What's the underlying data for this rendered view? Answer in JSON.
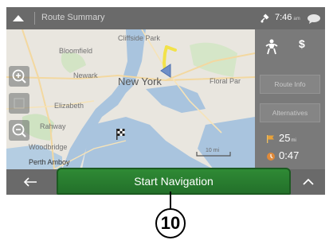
{
  "topbar": {
    "up_icon": "chevron-up-icon",
    "title": "Route Summary",
    "satellite_icon": "satellite-icon",
    "time": "7:46",
    "ampm": "am",
    "chat_icon": "speech-bubble-icon"
  },
  "map": {
    "labels": {
      "cliffside_park": "Cliffside Park",
      "bloomfield": "Bloomfield",
      "newark": "Newark",
      "new_york": "New York",
      "floral_park": "Floral Par",
      "elizabeth": "Elizabeth",
      "rahway": "Rahway",
      "woodbridge": "Woodbridge",
      "perth_amboy": "Perth Amboy"
    },
    "scale_label": "10 mi",
    "controls": {
      "zoom_in_icon": "zoom-in-icon",
      "zoom_out_icon": "zoom-out-icon",
      "pan_icon": "pan-icon"
    },
    "route_color": "#f2e24a",
    "destination_icon": "checkered-flag-icon",
    "position_icon": "navigation-arrow-icon"
  },
  "panel": {
    "poi_icon": "poi-icon",
    "toll_icon": "$",
    "route_info": "Route Info",
    "alternatives": "Alternatives",
    "distance_value": "25",
    "distance_unit": "mi",
    "distance_icon": "distance-flag-icon",
    "time_value": "0:47",
    "time_icon": "time-flag-icon"
  },
  "bottombar": {
    "back_icon": "arrow-left-icon",
    "start_navigation": "Start Navigation",
    "chevron_icon": "chevron-up-icon",
    "start_color": "#2a7d31"
  },
  "callout": {
    "number": "10"
  }
}
